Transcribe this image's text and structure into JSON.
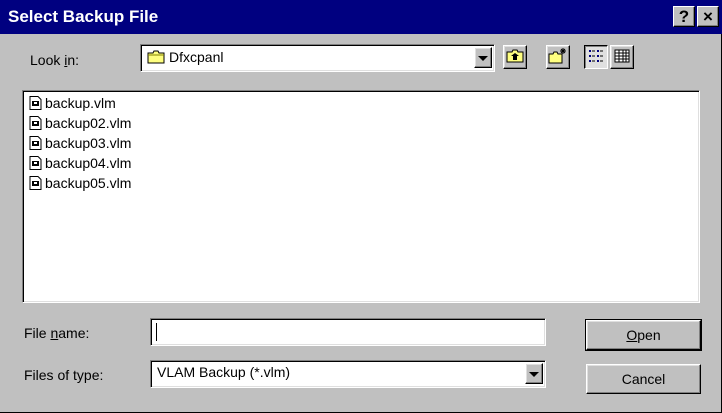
{
  "window": {
    "title": "Select Backup File",
    "help_glyph": "?",
    "close_glyph": "×"
  },
  "look_in": {
    "label_pre": "Look ",
    "label_accel": "i",
    "label_post": "n:",
    "value": "Dfxcpanl",
    "icon": "folder-icon"
  },
  "toolbar": {
    "up_one_level": "up-folder-icon",
    "new_folder": "new-folder-icon",
    "list_view": "list-view-icon",
    "details_view": "details-view-icon"
  },
  "files": [
    {
      "name": "backup.vlm",
      "icon": "vlm-file-icon"
    },
    {
      "name": "backup02.vlm",
      "icon": "vlm-file-icon"
    },
    {
      "name": "backup03.vlm",
      "icon": "vlm-file-icon"
    },
    {
      "name": "backup04.vlm",
      "icon": "vlm-file-icon"
    },
    {
      "name": "backup05.vlm",
      "icon": "vlm-file-icon"
    }
  ],
  "file_name": {
    "label_pre": "File ",
    "label_accel": "n",
    "label_post": "ame:",
    "value": ""
  },
  "file_type": {
    "label": "Files of type:",
    "value": "VLAM Backup (*.vlm)"
  },
  "buttons": {
    "open_accel": "O",
    "open_rest": "pen",
    "cancel": "Cancel"
  },
  "colors": {
    "title_bar": "#000080",
    "face": "#c0c0c0",
    "field": "#ffffff"
  }
}
